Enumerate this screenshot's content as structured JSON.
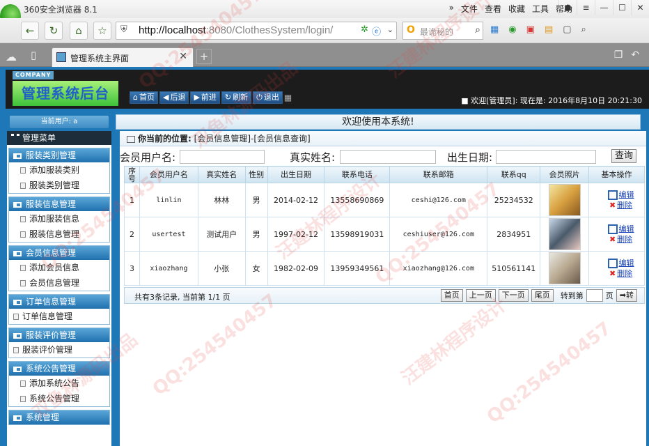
{
  "browser": {
    "app_title": "360安全浏览器 8.1",
    "menus": [
      "文件",
      "查看",
      "收藏",
      "工具",
      "帮助"
    ],
    "url_host": "http://localhost",
    "url_rest": ":8080/ClothesSystem/login/",
    "search_placeholder": "最诡秘的",
    "tab_label": "管理系统主界面"
  },
  "header": {
    "company": "COMPANY",
    "title": "管理系统后台",
    "buttons": [
      {
        "icon": "home-icon",
        "label": "首页"
      },
      {
        "icon": "arrow-left-icon",
        "label": "后退"
      },
      {
        "icon": "arrow-right-icon",
        "label": "前进"
      },
      {
        "icon": "refresh-icon",
        "label": "刷新"
      },
      {
        "icon": "power-icon",
        "label": "退出"
      }
    ],
    "welcome": "欢迎[管理员]:  现在是: 2016年8月10日 20:21:30"
  },
  "user_bar": "当前用户: a",
  "welcome_bar": "欢迎使用本系统!",
  "sidebar": {
    "menu_title": "管理菜单",
    "groups": [
      {
        "title": "服装类别管理",
        "items": [
          "添加服装类别",
          "服装类别管理"
        ]
      },
      {
        "title": "服装信息管理",
        "items": [
          "添加服装信息",
          "服装信息管理"
        ]
      },
      {
        "title": "会员信息管理",
        "items": [
          "添加会员信息",
          "会员信息管理"
        ]
      },
      {
        "title": "订单信息管理",
        "items": [
          "订单信息管理"
        ]
      },
      {
        "title": "服装评价管理",
        "items": [
          "服装评价管理"
        ]
      },
      {
        "title": "系统公告管理",
        "items": [
          "添加系统公告",
          "系统公告管理"
        ]
      },
      {
        "title": "系统管理",
        "items": []
      }
    ]
  },
  "breadcrumb": {
    "prefix": "你当前的位置:",
    "path": "[会员信息管理]-[会员信息查询]"
  },
  "search": {
    "username_label": "会员用户名:",
    "realname_label": "真实姓名:",
    "birthday_label": "出生日期:",
    "query_button": "查询"
  },
  "table": {
    "columns": [
      "序号",
      "会员用户名",
      "真实姓名",
      "性别",
      "出生日期",
      "联系电话",
      "联系邮箱",
      "联系qq",
      "会员照片",
      "基本操作"
    ],
    "rows": [
      {
        "no": "1",
        "username": "linlin",
        "realname": "林林",
        "gender": "男",
        "birthday": "2014-02-12",
        "phone": "13558690869",
        "email": "ceshi@126.com",
        "qq": "25234532"
      },
      {
        "no": "2",
        "username": "usertest",
        "realname": "测试用户",
        "gender": "男",
        "birthday": "1997-02-12",
        "phone": "13598919031",
        "email": "ceshiuser@126.com",
        "qq": "2834951"
      },
      {
        "no": "3",
        "username": "xiaozhang",
        "realname": "小张",
        "gender": "女",
        "birthday": "1982-02-09",
        "phone": "13959349561",
        "email": "xiaozhang@126.com",
        "qq": "510561141"
      }
    ],
    "edit_label": "编辑",
    "delete_label": "删除"
  },
  "pager": {
    "info": "共有3条记录, 当前第 1/1 页",
    "first": "首页",
    "prev": "上一页",
    "next": "下一页",
    "last": "尾页",
    "goto_label": "转到第",
    "page_suffix": "页",
    "go": "转"
  },
  "watermarks": [
    "QQ:254540457",
    "汪建林程序设计",
    "双鱼林源码出品"
  ]
}
